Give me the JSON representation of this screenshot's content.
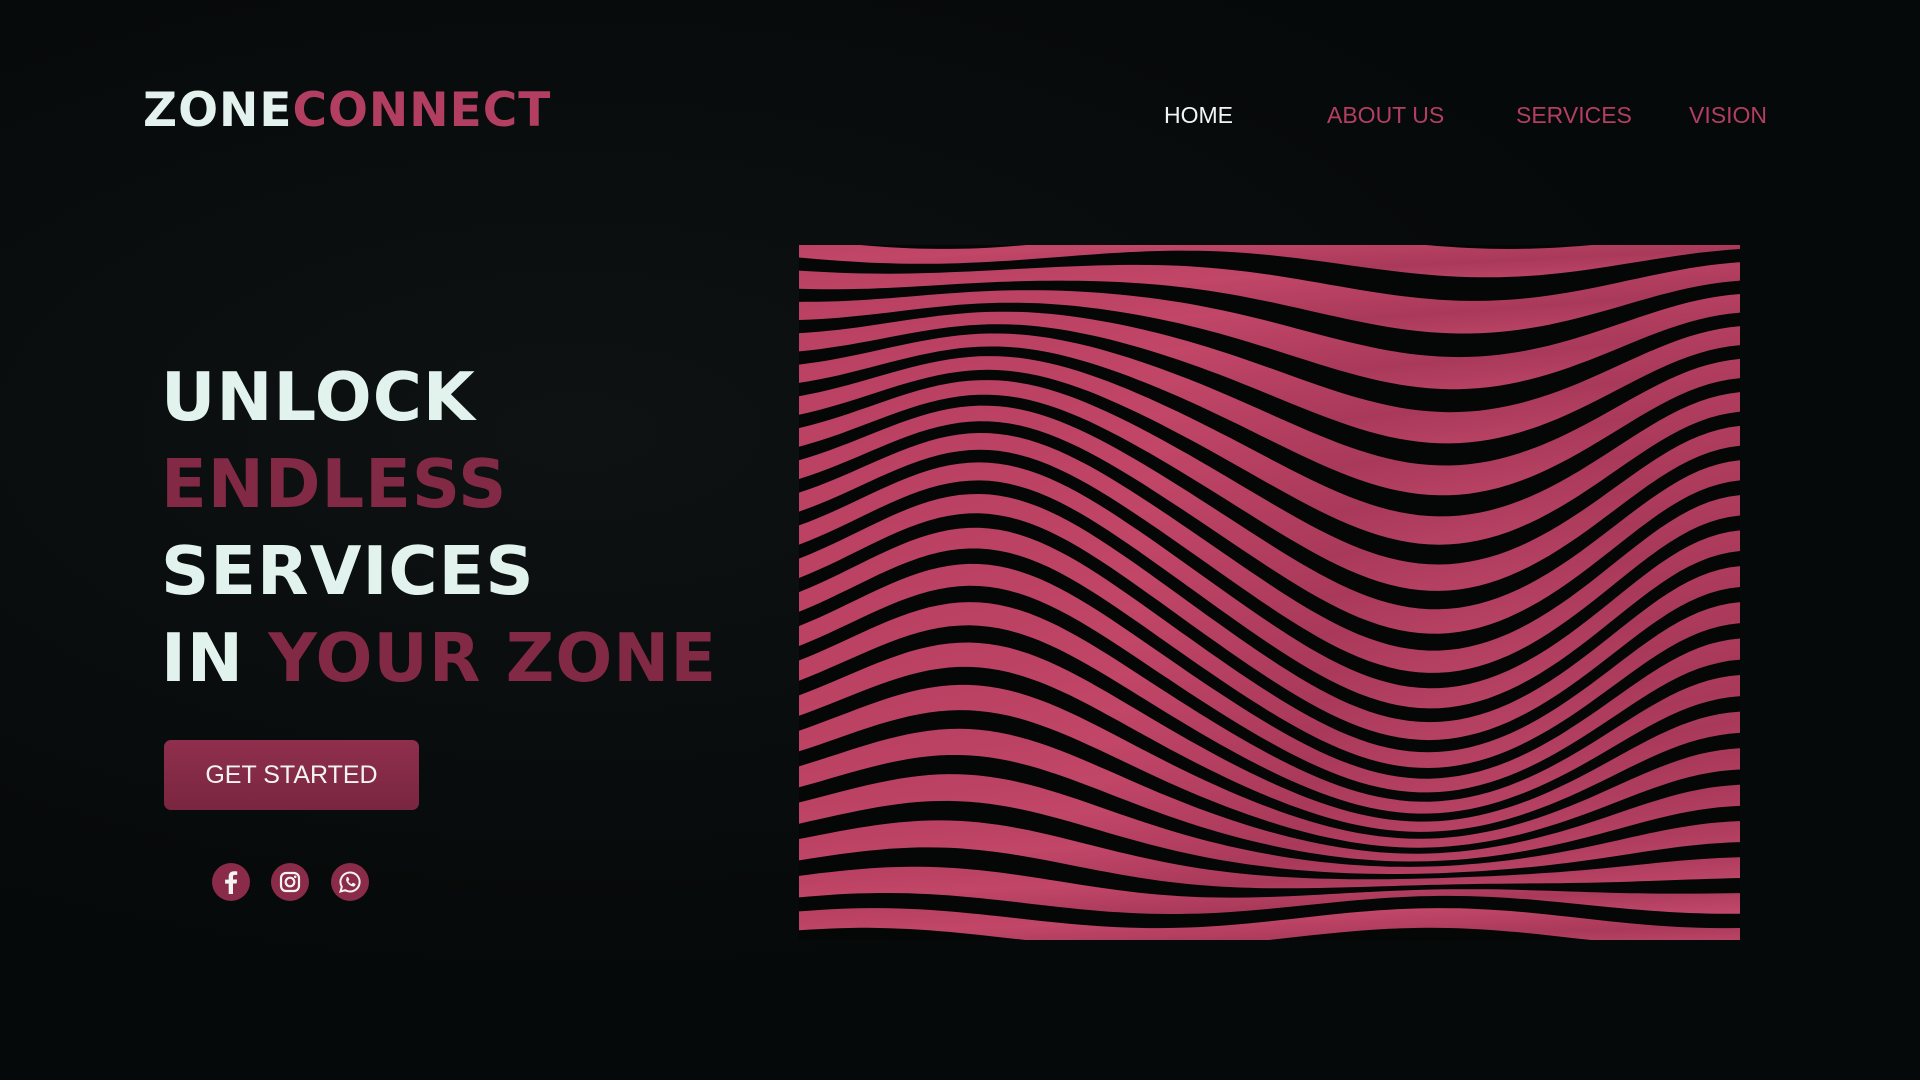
{
  "brand": {
    "name_part1": "ZONE",
    "name_part2": "CONNECT"
  },
  "nav": {
    "items": [
      {
        "label": "HOME",
        "active": true
      },
      {
        "label": "ABOUT US",
        "active": false
      },
      {
        "label": "SERVICES",
        "active": false
      },
      {
        "label": "VISION",
        "active": false
      }
    ]
  },
  "hero": {
    "line1": "UNLOCK",
    "line2": "ENDLESS",
    "line3": "SERVICES",
    "line4_white": "IN",
    "line4_accent": "YOUR ZONE"
  },
  "cta": {
    "label": "GET STARTED"
  },
  "social": {
    "icons": [
      "facebook-icon",
      "instagram-icon",
      "whatsapp-icon"
    ]
  },
  "colors": {
    "background": "#060909",
    "accent": "#b23f61",
    "accent_dark": "#822a45",
    "text_light": "#e2f3ee",
    "button": "#8a2b4a",
    "wave_pink": "#c14668"
  }
}
